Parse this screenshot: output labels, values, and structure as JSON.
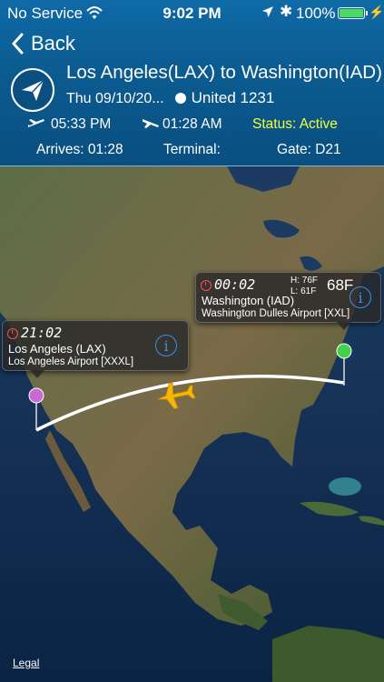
{
  "status_bar": {
    "carrier": "No Service",
    "time": "9:02 PM",
    "battery_percent": "100%",
    "icons": [
      "wifi-icon",
      "location-arrow-icon",
      "bluetooth-icon",
      "battery-icon",
      "charging-bolt-icon"
    ]
  },
  "nav": {
    "back_label": "Back"
  },
  "flight": {
    "route": "Los Angeles(LAX) to Washington(IAD)",
    "date": "Thu 09/10/20...",
    "airline_flight": "United 1231",
    "departure_time": "05:33 PM",
    "arrival_time": "01:28 AM",
    "status": "Status: Active",
    "arrives": "Arrives: 01:28",
    "terminal": "Terminal:",
    "gate": "Gate: D21"
  },
  "map": {
    "origin": {
      "local_time": "21:02",
      "city": "Los Angeles (LAX)",
      "airport": "Los Angeles Airport [XXXL]",
      "pin_color": "#c86ad6"
    },
    "destination": {
      "local_time": "00:02",
      "city": "Washington (IAD)",
      "airport": "Washington Dulles Airport [XXL]",
      "weather_high": "H: 76F",
      "weather_low": "L: 61F",
      "weather_temp": "68F",
      "pin_color": "#44d14a"
    },
    "legal_link": "Legal"
  },
  "colors": {
    "header_bg": "#0b5c92",
    "status_active": "#f2ff3a",
    "info_button": "#3a8fe8",
    "plane_marker": "#f5b700"
  }
}
